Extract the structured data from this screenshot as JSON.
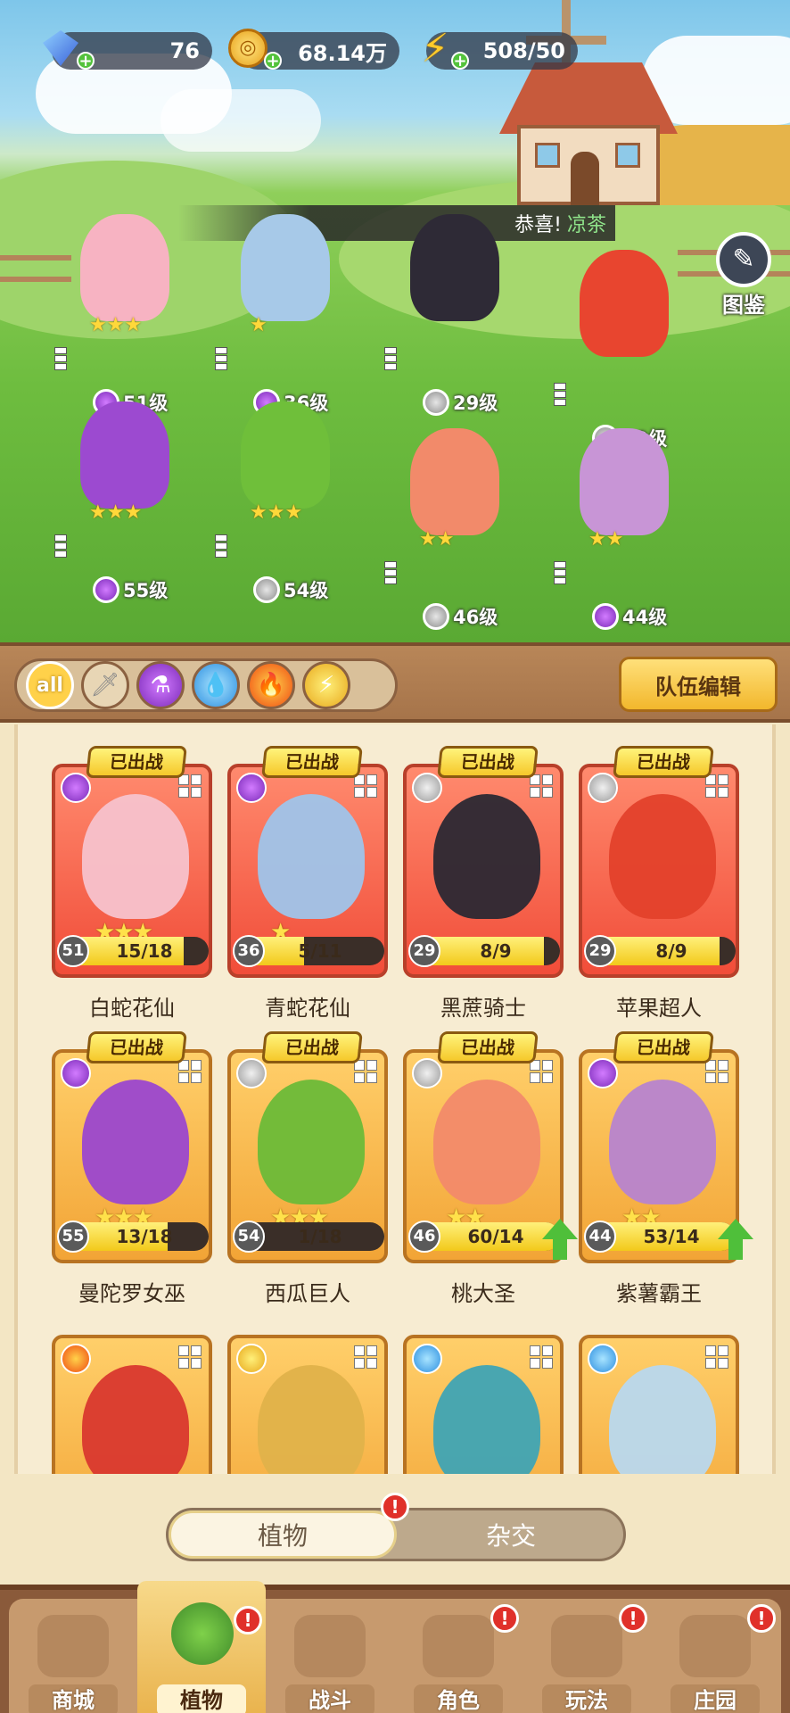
{
  "resources": {
    "gems": "76",
    "coins": "68.14万",
    "energy": "508/50"
  },
  "banner": {
    "prefix": "恭喜!",
    "highlight": "凉茶"
  },
  "atlas": {
    "label": "图鉴",
    "icon": "atlas-book-icon"
  },
  "team_plants": [
    {
      "level": "51级",
      "class": "potion",
      "stars": 3,
      "color": "#f7b3c2"
    },
    {
      "level": "36级",
      "class": "potion",
      "stars": 1,
      "color": "#a7c9e8"
    },
    {
      "level": "29级",
      "class": "sword",
      "stars": 0,
      "color": "#2e2a36"
    },
    {
      "level": "29级",
      "class": "sword",
      "stars": 0,
      "color": "#e8452f"
    },
    {
      "level": "55级",
      "class": "potion",
      "stars": 3,
      "color": "#9c4ad0"
    },
    {
      "level": "54级",
      "class": "sword",
      "stars": 3,
      "color": "#6fbf3a"
    },
    {
      "level": "46级",
      "class": "sword",
      "stars": 2,
      "color": "#f28a6a"
    },
    {
      "level": "44级",
      "class": "potion",
      "stars": 2,
      "color": "#c895d6"
    }
  ],
  "filters": {
    "items": [
      {
        "label": "all",
        "icon": "all-filter"
      },
      {
        "label": "",
        "icon": "sword-icon"
      },
      {
        "label": "",
        "icon": "potion-icon"
      },
      {
        "label": "",
        "icon": "water-drop-icon"
      },
      {
        "label": "",
        "icon": "fire-icon"
      },
      {
        "label": "",
        "icon": "lightning-icon"
      }
    ],
    "team_edit": "队伍编辑"
  },
  "cards": [
    {
      "name": "白蛇花仙",
      "level": "51",
      "progress": "15/18",
      "fill": 0.83,
      "stars": "★★★",
      "deployed": "已出战",
      "frame": "red",
      "class": "potion",
      "art": "#f7c2cc",
      "upgrade": false
    },
    {
      "name": "青蛇花仙",
      "level": "36",
      "progress": "5/11",
      "fill": 0.45,
      "stars": "★",
      "deployed": "已出战",
      "frame": "red",
      "class": "potion",
      "art": "#9fc4ea",
      "upgrade": false
    },
    {
      "name": "黑蔗骑士",
      "level": "29",
      "progress": "8/9",
      "fill": 0.89,
      "stars": "",
      "deployed": "已出战",
      "frame": "red",
      "class": "sword",
      "art": "#2b2833",
      "upgrade": false
    },
    {
      "name": "苹果超人",
      "level": "29",
      "progress": "8/9",
      "fill": 0.89,
      "stars": "",
      "deployed": "已出战",
      "frame": "red",
      "class": "sword",
      "art": "#e3412b",
      "upgrade": false
    },
    {
      "name": "曼陀罗女巫",
      "level": "55",
      "progress": "13/18",
      "fill": 0.72,
      "stars": "★★★",
      "deployed": "已出战",
      "frame": "gold",
      "class": "potion",
      "art": "#9b47cf",
      "upgrade": false
    },
    {
      "name": "西瓜巨人",
      "level": "54",
      "progress": "1/18",
      "fill": 0.06,
      "stars": "★★★",
      "deployed": "已出战",
      "frame": "gold",
      "class": "sword",
      "art": "#6cbb38",
      "upgrade": false
    },
    {
      "name": "桃大圣",
      "level": "46",
      "progress": "60/14",
      "fill": 1.0,
      "stars": "★★",
      "deployed": "已出战",
      "frame": "gold",
      "class": "sword",
      "art": "#f28a6a",
      "upgrade": true
    },
    {
      "name": "紫薯霸王",
      "level": "44",
      "progress": "53/14",
      "fill": 1.0,
      "stars": "★★",
      "deployed": "已出战",
      "frame": "gold",
      "class": "potion",
      "art": "#b784cf",
      "upgrade": true
    },
    {
      "name": "",
      "level": "",
      "progress": "",
      "fill": 0,
      "stars": "",
      "deployed": "",
      "frame": "gold",
      "class": "fire",
      "art": "#d9382e",
      "upgrade": false
    },
    {
      "name": "",
      "level": "",
      "progress": "",
      "fill": 0,
      "stars": "",
      "deployed": "",
      "frame": "gold",
      "class": "bolt-c",
      "art": "#e0b24a",
      "upgrade": false
    },
    {
      "name": "",
      "level": "",
      "progress": "",
      "fill": 0,
      "stars": "",
      "deployed": "",
      "frame": "gold",
      "class": "water",
      "art": "#3fa4b4",
      "upgrade": false
    },
    {
      "name": "",
      "level": "",
      "progress": "",
      "fill": 0,
      "stars": "",
      "deployed": "",
      "frame": "gold",
      "class": "water",
      "art": "#b8d8ee",
      "upgrade": false
    }
  ],
  "toggle": {
    "left": "植物",
    "right": "杂交",
    "badge": "!"
  },
  "nav": {
    "tabs": [
      {
        "label": "商城",
        "icon": "shop-icon",
        "badge": false,
        "active": false
      },
      {
        "label": "植物",
        "icon": "plants-icon",
        "badge": true,
        "active": true
      },
      {
        "label": "战斗",
        "icon": "battle-windmill-icon",
        "badge": false,
        "active": false
      },
      {
        "label": "角色",
        "icon": "character-icon",
        "badge": true,
        "active": false
      },
      {
        "label": "玩法",
        "icon": "gameplay-icon",
        "badge": true,
        "active": false
      },
      {
        "label": "庄园",
        "icon": "manor-icon",
        "badge": true,
        "active": false
      }
    ],
    "badge_text": "!"
  }
}
